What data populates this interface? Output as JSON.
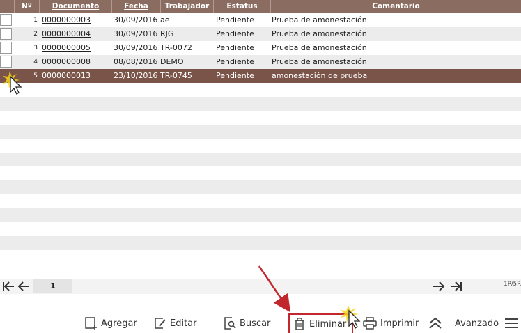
{
  "grid": {
    "headers": {
      "num": "Nº",
      "documento": "Documento",
      "fecha": "Fecha",
      "trabajador": "Trabajador",
      "estatus": "Estatus",
      "comentario": "Comentario"
    },
    "rows": [
      {
        "num": "1",
        "documento": "0000000003",
        "fecha": "30/09/2016",
        "trabajador": "ae",
        "estatus": "Pendiente",
        "comentario": "Prueba de amonestación"
      },
      {
        "num": "2",
        "documento": "0000000004",
        "fecha": "30/09/2016",
        "trabajador": "RJG",
        "estatus": "Pendiente",
        "comentario": "Prueba de amonestación"
      },
      {
        "num": "3",
        "documento": "0000000005",
        "fecha": "30/09/2016",
        "trabajador": "TR-0072",
        "estatus": "Pendiente",
        "comentario": "Prueba de amonestación"
      },
      {
        "num": "4",
        "documento": "0000000008",
        "fecha": "08/08/2016",
        "trabajador": "DEMO",
        "estatus": "Pendiente",
        "comentario": "Prueba de amonestación"
      },
      {
        "num": "5",
        "documento": "0000000013",
        "fecha": "23/10/2016",
        "trabajador": "TR-0745",
        "estatus": "Pendiente",
        "comentario": "amonestación de prueba"
      }
    ],
    "selected_row": 5
  },
  "pager": {
    "page": "1",
    "info": "1P/5R"
  },
  "toolbar": {
    "agregar": "Agregar",
    "editar": "Editar",
    "buscar": "Buscar",
    "eliminar": "Eliminar",
    "imprimir": "Imprimir",
    "avanzado": "Avanzado"
  },
  "colors": {
    "header": "#8b6c61",
    "selected_row": "#7a5448",
    "highlight_box": "#c1272d",
    "annotation_arrow": "#c1272d"
  },
  "icons": [
    "first-page-icon",
    "prev-page-icon",
    "next-page-icon",
    "last-page-icon",
    "add-icon",
    "edit-icon",
    "search-icon",
    "trash-icon",
    "print-icon",
    "collapse-up-icon",
    "menu-icon",
    "mouse-cursor-icon"
  ]
}
